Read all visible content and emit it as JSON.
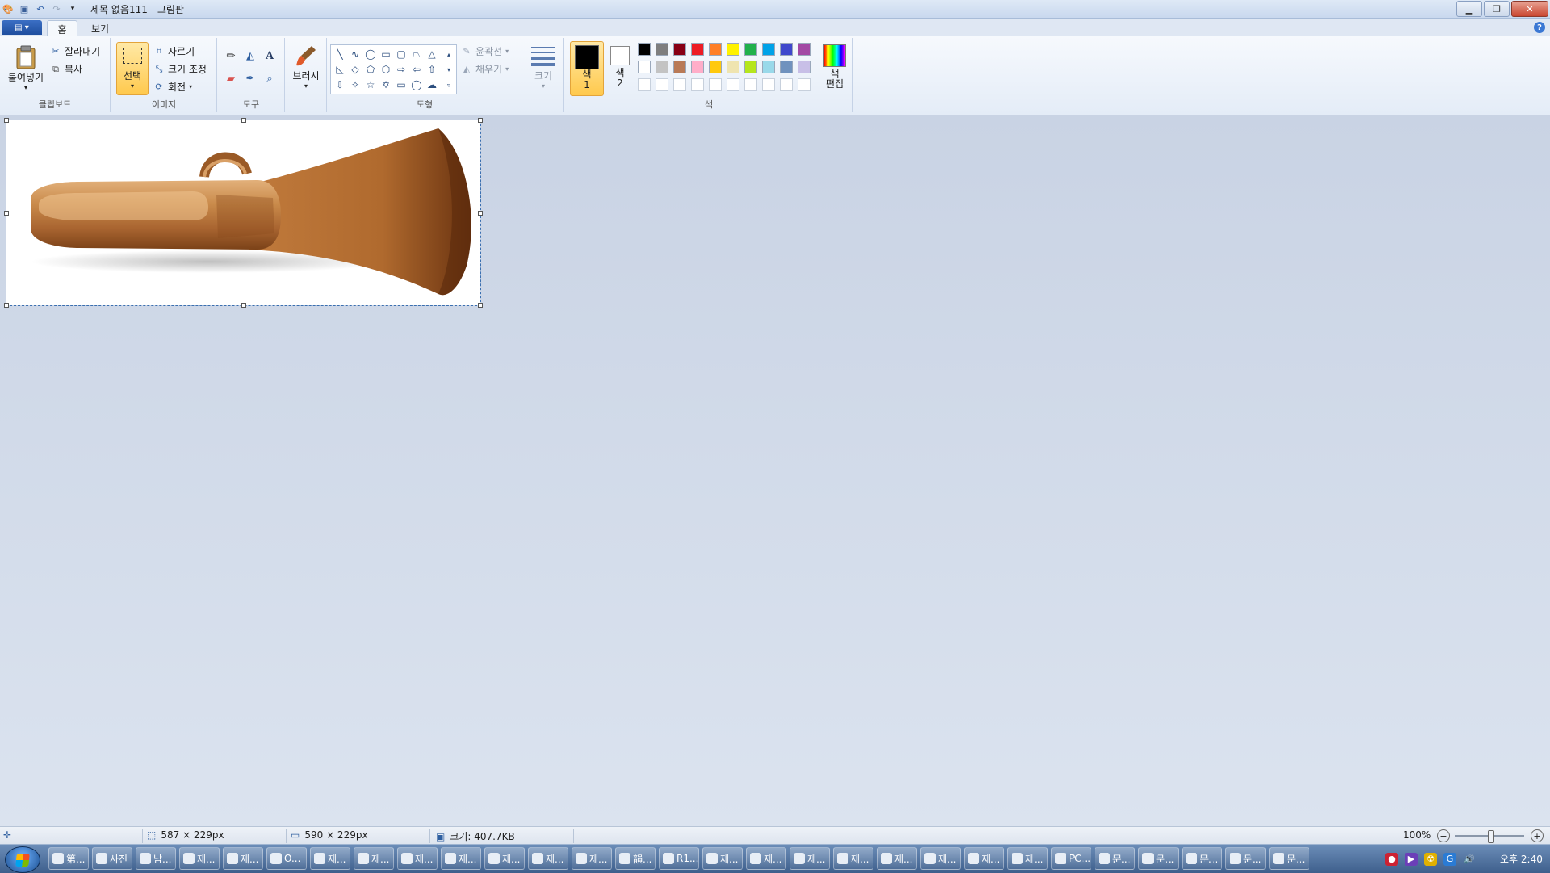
{
  "window": {
    "title": "제목 없음111 - 그림판"
  },
  "tabs": [
    {
      "label": "홈",
      "active": true
    },
    {
      "label": "보기",
      "active": false
    }
  ],
  "clipboard": {
    "paste": "붙여넣기",
    "cut": "잘라내기",
    "copy": "복사",
    "group": "클립보드"
  },
  "image": {
    "select": "선택",
    "crop": "자르기",
    "resize": "크기 조정",
    "rotate": "회전",
    "group": "이미지"
  },
  "tools": {
    "group": "도구"
  },
  "brushes": {
    "label": "브러시"
  },
  "shapes": {
    "outline": "윤곽선",
    "fill": "채우기",
    "group": "도형"
  },
  "size": {
    "label": "크기"
  },
  "colors": {
    "color1": "색\n1",
    "color1_a": "색",
    "color1_b": "1",
    "color2_a": "색",
    "color2_b": "2",
    "edit_a": "색",
    "edit_b": "편집",
    "group": "색",
    "palette_row1": [
      "#000000",
      "#7f7f7f",
      "#880015",
      "#ed1c24",
      "#ff7f27",
      "#fff200",
      "#22b14c",
      "#00a2e8",
      "#3f48cc",
      "#a349a4"
    ],
    "palette_row2": [
      "#ffffff",
      "#c3c3c3",
      "#b97a57",
      "#ffaec9",
      "#ffc90e",
      "#efe4b0",
      "#b5e61d",
      "#99d9ea",
      "#7092be",
      "#c8bfe7"
    ]
  },
  "status": {
    "selection": "587 × 229px",
    "canvas": "590 × 229px",
    "filesize": "크기: 407.7KB",
    "zoom": "100%"
  },
  "taskbar": {
    "items": [
      "第...",
      "사진",
      "남...",
      "제...",
      "제...",
      "O...",
      "제...",
      "제...",
      "제...",
      "제...",
      "제...",
      "제...",
      "제...",
      "韻...",
      "R1...",
      "제...",
      "제...",
      "제...",
      "제...",
      "제...",
      "제...",
      "제...",
      "제...",
      "PC...",
      "문...",
      "문...",
      "문...",
      "문...",
      "문..."
    ],
    "clock": "오후 2:40"
  }
}
